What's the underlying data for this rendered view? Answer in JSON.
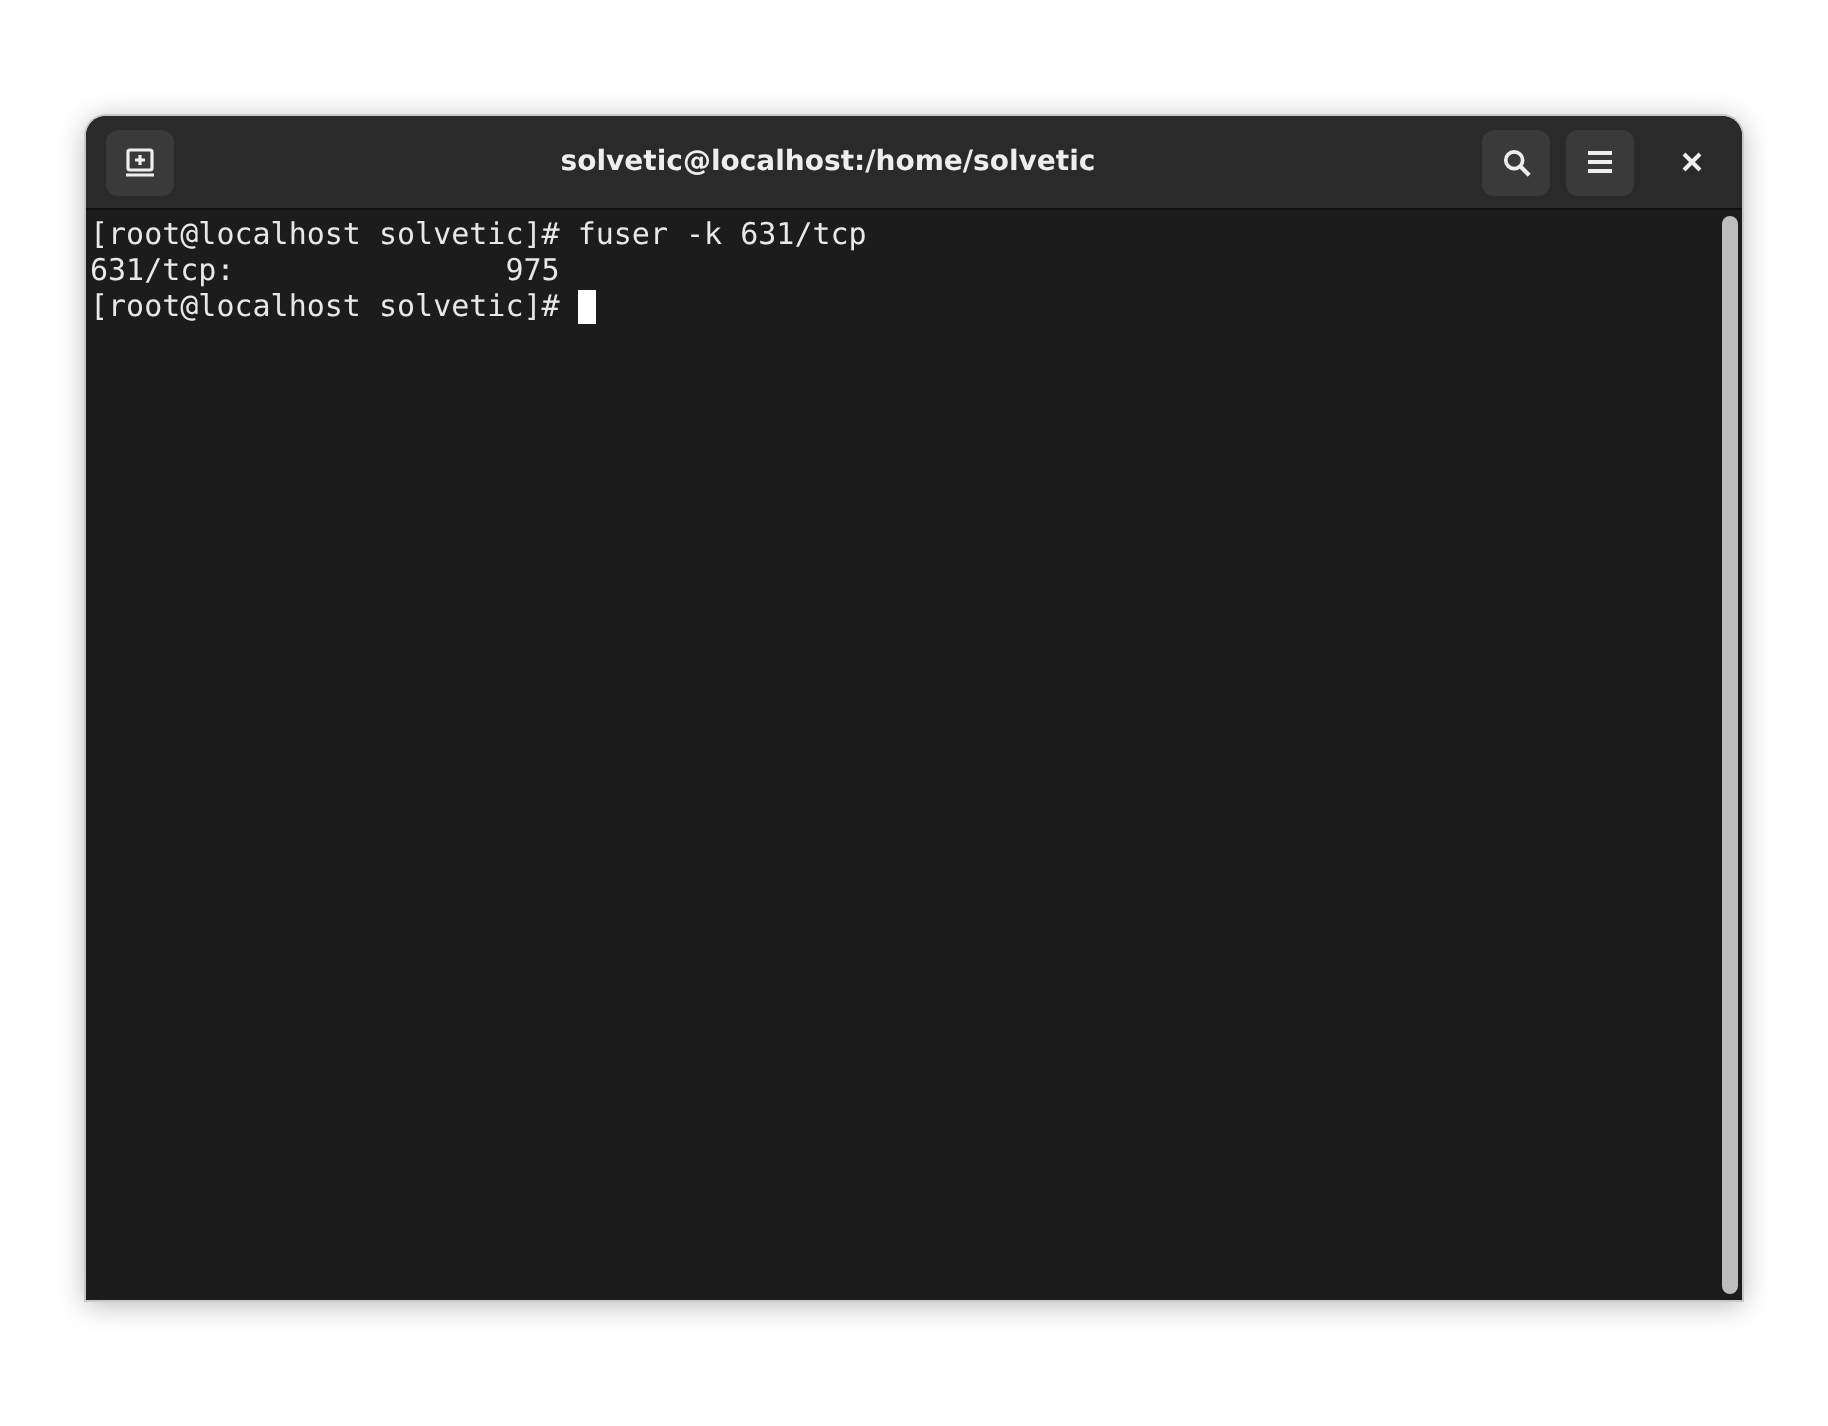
{
  "window": {
    "title": "solvetic@localhost:/home/solvetic"
  },
  "terminal": {
    "lines": [
      {
        "text": "[root@localhost solvetic]# fuser -k 631/tcp",
        "cursor": false
      },
      {
        "text": "631/tcp:               975",
        "cursor": false
      },
      {
        "text": "[root@localhost solvetic]# ",
        "cursor": true
      }
    ]
  }
}
